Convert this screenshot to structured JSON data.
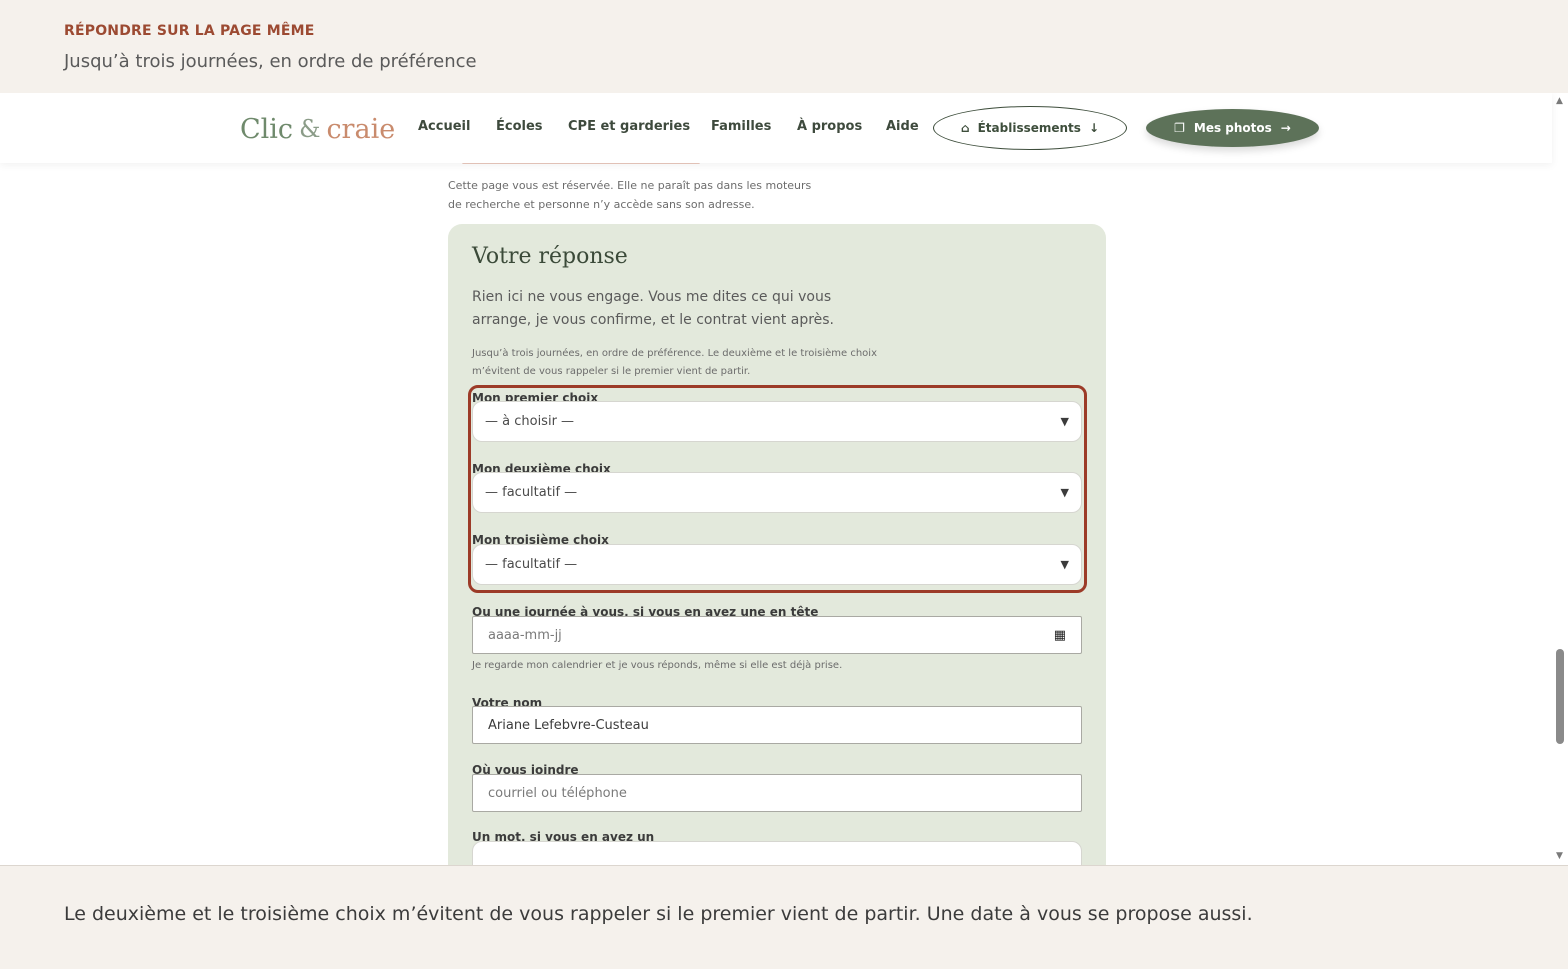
{
  "banner": {
    "eyebrow": "RÉPONDRE SUR LA PAGE MÊME",
    "subtitle": "Jusqu’à trois journées, en ordre de préférence"
  },
  "nav": {
    "logo_part1": "Clic",
    "logo_amp": "&",
    "logo_part2": "craie",
    "links": [
      "Accueil",
      "Écoles",
      "CPE et garderies",
      "Familles",
      "À propos",
      "Aide"
    ],
    "etablissements_label": "Établissements",
    "photos_label": "Mes photos"
  },
  "page": {
    "privacy_note": "Cette page vous est réservée. Elle ne paraît pas dans les moteurs de recherche et personne n’y accède sans son adresse."
  },
  "card": {
    "title": "Votre réponse",
    "lead": "Rien ici ne vous engage. Vous me dites ce qui vous arrange, je vous confirme, et le contrat vient après.",
    "note": "Jusqu’à trois journées, en ordre de préférence. Le deuxième et le troisième choix m’évitent de vous rappeler si le premier vient de partir.",
    "choice1_label": "Mon premier choix",
    "choice1_value": "— à choisir —",
    "choice2_label": "Mon deuxième choix",
    "choice2_value": "— facultatif —",
    "choice3_label": "Mon troisième choix",
    "choice3_value": "— facultatif —",
    "custom_date_label": "Ou une journée à vous, si vous en avez une en tête",
    "custom_date_placeholder": "aaaa-mm-jj",
    "custom_date_help": "Je regarde mon calendrier et je vous réponds, même si elle est déjà prise.",
    "name_label": "Votre nom",
    "name_value": "Ariane Lefebvre-Custeau",
    "contact_label": "Où vous joindre",
    "contact_placeholder": "courriel ou téléphone",
    "message_label": "Un mot, si vous en avez un"
  },
  "caption": "Le deuxième et le troisième choix m’évitent de vous rappeler si le premier vient de partir. Une date à vous se propose aussi.",
  "colors": {
    "accent_rust": "#9c3b28",
    "card_bg": "#e3e9dc",
    "primary_green": "#5d7259"
  },
  "icons": {
    "select_caret": "caret-down-icon",
    "calendar": "calendar-icon",
    "building": "building-icon",
    "arrow_down": "arrow-down-icon",
    "photos": "photos-icon",
    "arrow_right": "arrow-right-icon"
  }
}
